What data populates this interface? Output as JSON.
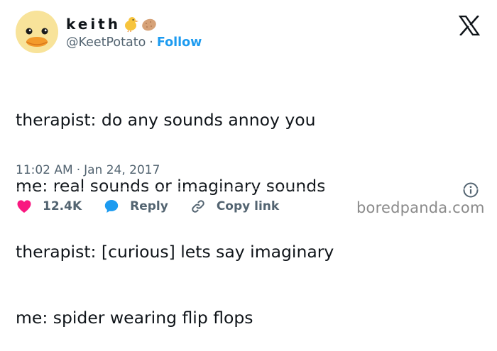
{
  "author": {
    "display_name": "keith",
    "display_name_emojis": [
      "chick-emoji",
      "potato-emoji"
    ],
    "handle": "@KeetPotato",
    "separator": "·",
    "follow_label": "Follow"
  },
  "tweet": {
    "lines": [
      "therapist: do any sounds annoy you",
      "me: real sounds or imaginary sounds",
      "therapist: [curious] lets say imaginary",
      "me: spider wearing flip flops"
    ]
  },
  "meta": {
    "time": "11:02 AM",
    "separator": "·",
    "date": "Jan 24, 2017"
  },
  "actions": {
    "like_count": "12.4K",
    "reply_label": "Reply",
    "copy_link_label": "Copy link"
  },
  "watermark": "boredpanda.com",
  "colors": {
    "accent": "#1d9bf0",
    "like": "#f91880",
    "text": "#0f1419",
    "muted": "#536471"
  },
  "icons": {
    "brand": "x-logo-icon",
    "info": "info-icon",
    "like": "heart-icon",
    "reply": "reply-bubble-icon",
    "copy": "link-icon"
  }
}
